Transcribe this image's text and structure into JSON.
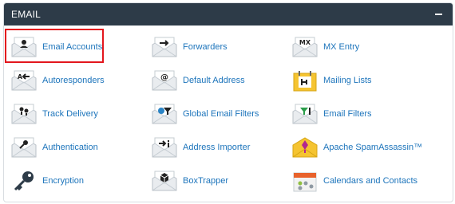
{
  "section": {
    "title": "EMAIL",
    "collapse_symbol": "–"
  },
  "items": [
    {
      "label": "Email Accounts",
      "icon": "email-accounts-icon"
    },
    {
      "label": "Forwarders",
      "icon": "forwarders-icon"
    },
    {
      "label": "MX Entry",
      "icon": "mx-entry-icon"
    },
    {
      "label": "Autoresponders",
      "icon": "autoresponders-icon"
    },
    {
      "label": "Default Address",
      "icon": "default-address-icon"
    },
    {
      "label": "Mailing Lists",
      "icon": "mailing-lists-icon"
    },
    {
      "label": "Track Delivery",
      "icon": "track-delivery-icon"
    },
    {
      "label": "Global Email Filters",
      "icon": "global-email-filters-icon"
    },
    {
      "label": "Email Filters",
      "icon": "email-filters-icon"
    },
    {
      "label": "Authentication",
      "icon": "authentication-icon"
    },
    {
      "label": "Address Importer",
      "icon": "address-importer-icon"
    },
    {
      "label": "Apache SpamAssassin™",
      "icon": "spamassassin-icon"
    },
    {
      "label": "Encryption",
      "icon": "encryption-icon"
    },
    {
      "label": "BoxTrapper",
      "icon": "boxtrapper-icon"
    },
    {
      "label": "Calendars and Contacts",
      "icon": "calendars-contacts-icon"
    }
  ],
  "highlighted_item": "Email Accounts",
  "colors": {
    "header_bg": "#2d3b48",
    "link": "#1c74bb",
    "highlight": "#e3161d"
  }
}
